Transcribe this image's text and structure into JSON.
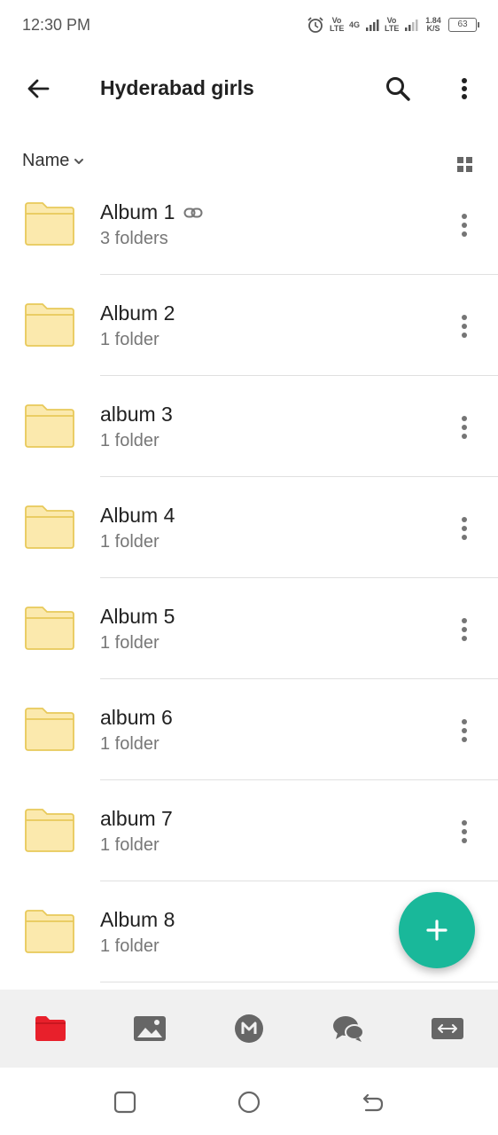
{
  "status_bar": {
    "time": "12:30 PM",
    "network_1": "Vo LTE",
    "network_2": "4G",
    "network_3": "Vo LTE",
    "speed": "1.84 K/S",
    "battery": "63"
  },
  "app_bar": {
    "title": "Hyderabad girls"
  },
  "sort": {
    "label": "Name"
  },
  "folders": [
    {
      "name": "Album 1",
      "meta": "3 folders",
      "shared": true
    },
    {
      "name": "Album 2",
      "meta": "1 folder",
      "shared": false
    },
    {
      "name": "album 3",
      "meta": "1 folder",
      "shared": false
    },
    {
      "name": "Album 4",
      "meta": "1 folder",
      "shared": false
    },
    {
      "name": "Album 5",
      "meta": "1 folder",
      "shared": false
    },
    {
      "name": "album 6",
      "meta": "1 folder",
      "shared": false
    },
    {
      "name": "album 7",
      "meta": "1 folder",
      "shared": false
    },
    {
      "name": "Album 8",
      "meta": "1 folder",
      "shared": false
    }
  ],
  "bottom_nav": {
    "items": [
      {
        "icon": "folder-icon",
        "active": true
      },
      {
        "icon": "photos-icon",
        "active": false
      },
      {
        "icon": "mega-icon",
        "active": false
      },
      {
        "icon": "chat-icon",
        "active": false
      },
      {
        "icon": "transfers-icon",
        "active": false
      }
    ]
  },
  "colors": {
    "accent": "#19b89a",
    "active_nav": "#e8202b",
    "folder_fill": "#fbe9ad",
    "folder_stroke": "#e8c95a"
  }
}
